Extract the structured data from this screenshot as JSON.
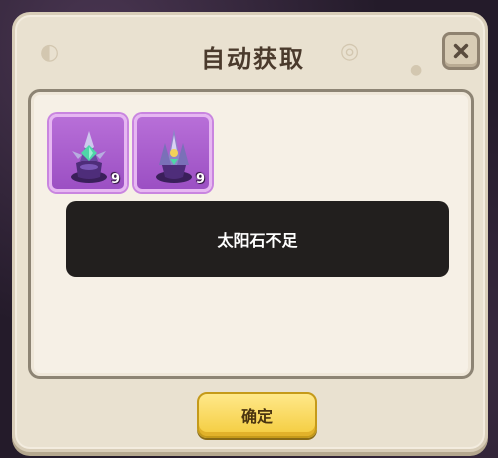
{
  "dialog": {
    "title": "自动获取",
    "close_icon": "close-icon",
    "confirm_label": "确定"
  },
  "items": [
    {
      "name": "crystal-pedestal-icon",
      "count": "9"
    },
    {
      "name": "crystal-cluster-icon",
      "count": "9"
    }
  ],
  "toast": {
    "message": "太阳石不足"
  },
  "colors": {
    "panel": "#f6f0e6",
    "item_bg": "#9b4fc3",
    "toast_bg": "#221f1e",
    "confirm_button": "#f4cc3e"
  }
}
